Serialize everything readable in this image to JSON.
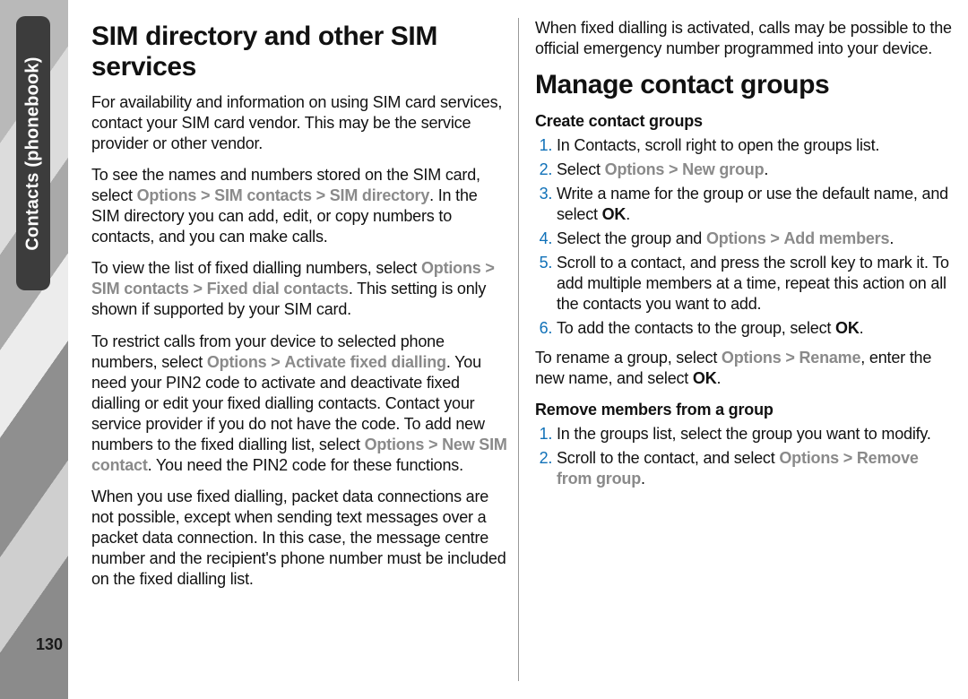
{
  "meta": {
    "side_tab": "Contacts (phonebook)",
    "page_number": "130"
  },
  "left": {
    "h1": "SIM directory and other SIM services",
    "p1_a": "For availability and information on using SIM card services, contact your SIM card vendor. This may be the service provider or other vendor.",
    "p2_a": "To see the names and numbers stored on the SIM card, select ",
    "p2_m1": "Options",
    "p2_m2": "SIM contacts",
    "p2_m3": "SIM directory",
    "p2_b": ". In the SIM directory you can add, edit, or copy numbers to contacts, and you can make calls.",
    "p3_a": "To view the list of fixed dialling numbers, select ",
    "p3_m1": "Options",
    "p3_m2": "SIM contacts",
    "p3_m3": "Fixed dial contacts",
    "p3_b": ". This setting is only shown if supported by your SIM card.",
    "p4_a": "To restrict calls from your device to selected phone numbers, select ",
    "p4_m1": "Options",
    "p4_m2": "Activate fixed dialling",
    "p4_b": ". You need your PIN2 code to activate and deactivate fixed dialling or edit your fixed dialling contacts. Contact your service provider if you do not have the code. To add new numbers to the fixed dialling list, select ",
    "p4_m3": "Options",
    "p4_m4": "New SIM contact",
    "p4_c": ". You need the PIN2 code for these functions.",
    "p5": "When you use fixed dialling, packet data connections are not possible, except when sending text messages over a packet data connection. In this case, the message centre number and the recipient's phone number must be included on the fixed dialling list."
  },
  "right": {
    "p0": "When fixed dialling is activated, calls may be possible to the official emergency number programmed into your device.",
    "h1": "Manage contact groups",
    "sub1": "Create contact groups",
    "li1": "In Contacts, scroll right to open the groups list.",
    "li2_a": "Select ",
    "li2_m1": "Options",
    "li2_m2": "New group",
    "li2_b": ".",
    "li3_a": "Write a name for the group or use the default name, and select ",
    "li3_ok": "OK",
    "li3_b": ".",
    "li4_a": "Select the group and ",
    "li4_m1": "Options",
    "li4_m2": "Add members",
    "li4_b": ".",
    "li5": "Scroll to a contact, and press the scroll key to mark it. To add multiple members at a time, repeat this action on all the contacts you want to add.",
    "li6_a": "To add the contacts to the group, select ",
    "li6_ok": "OK",
    "li6_b": ".",
    "p1_a": "To rename a group, select ",
    "p1_m1": "Options",
    "p1_m2": "Rename",
    "p1_b": ", enter the new name, and select ",
    "p1_ok": "OK",
    "p1_c": ".",
    "sub2": "Remove members from a group",
    "rli1": "In the groups list, select the group you want to modify.",
    "rli2_a": "Scroll to the contact, and select ",
    "rli2_m1": "Options",
    "rli2_m2": "Remove from group",
    "rli2_b": "."
  },
  "glyphs": {
    "chevron": ">"
  }
}
